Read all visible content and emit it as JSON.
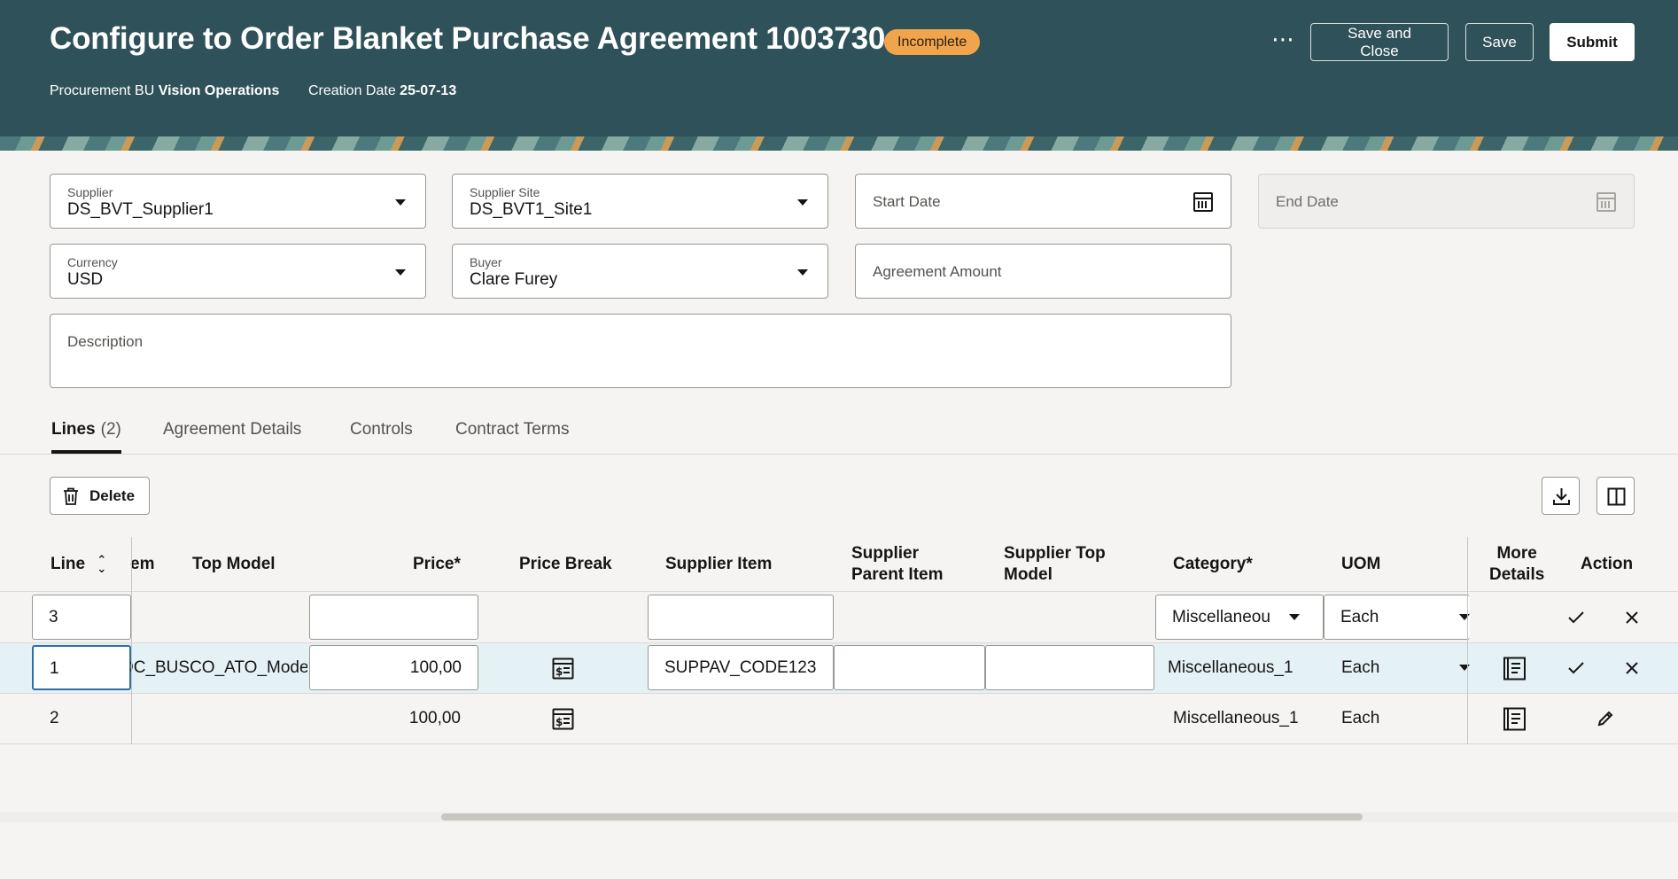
{
  "header": {
    "title": "Configure to Order Blanket Purchase Agreement 1003730",
    "status_badge": "Incomplete",
    "procurement_bu_label": "Procurement BU",
    "procurement_bu_value": "Vision Operations",
    "creation_date_label": "Creation Date",
    "creation_date_value": "25-07-13",
    "more_icon": "ellipsis-icon",
    "buttons": {
      "save_and_close": "Save and Close",
      "save": "Save",
      "submit": "Submit"
    },
    "colors": {
      "background": "#2f5159",
      "badge": "#f0a54c"
    }
  },
  "form": {
    "supplier": {
      "label": "Supplier",
      "value": "DS_BVT_Supplier1"
    },
    "supplier_site": {
      "label": "Supplier Site",
      "value": "DS_BVT1_Site1"
    },
    "start_date": {
      "label": "Start Date",
      "value": ""
    },
    "end_date": {
      "label": "End Date",
      "value": ""
    },
    "currency": {
      "label": "Currency",
      "value": "USD"
    },
    "buyer": {
      "label": "Buyer",
      "value": "Clare Furey"
    },
    "agreement_amount": {
      "label": "Agreement Amount",
      "value": ""
    },
    "description": {
      "label": "Description",
      "value": ""
    }
  },
  "tabs": [
    {
      "label": "Lines",
      "count": "(2)",
      "active": true
    },
    {
      "label": "Agreement Details"
    },
    {
      "label": "Controls"
    },
    {
      "label": "Contract Terms"
    }
  ],
  "toolbar": {
    "delete_label": "Delete",
    "export_icon": "download-icon",
    "columns_icon": "columns-icon"
  },
  "table": {
    "columns": {
      "line": "Line",
      "item_partial": "em",
      "top_model": "Top Model",
      "price": "Price*",
      "price_break": "Price Break",
      "supplier_item": "Supplier Item",
      "supplier_parent_item_1": "Supplier",
      "supplier_parent_item_2": "Parent Item",
      "supplier_top_model_1": "Supplier Top",
      "supplier_top_model_2": "Model",
      "category": "Category*",
      "uom": "UOM",
      "more_details_1": "More",
      "more_details_2": "Details",
      "action": "Action"
    },
    "rows": [
      {
        "line": "3",
        "item": "",
        "price": "",
        "supplier_item": "",
        "category": "Miscellaneou",
        "uom": "Each",
        "mode": "new"
      },
      {
        "line": "1",
        "item": "DC_BUSCO_ATO_Model_",
        "price": "100,00",
        "supplier_item": "SUPPAV_CODE123",
        "supplier_parent_item": "",
        "supplier_top_model": "",
        "category": "Miscellaneous_1",
        "uom": "Each",
        "mode": "edit"
      },
      {
        "line": "2",
        "item": "",
        "price": "100,00",
        "supplier_item": "",
        "category": "Miscellaneous_1",
        "uom": "Each",
        "mode": "view"
      }
    ]
  }
}
